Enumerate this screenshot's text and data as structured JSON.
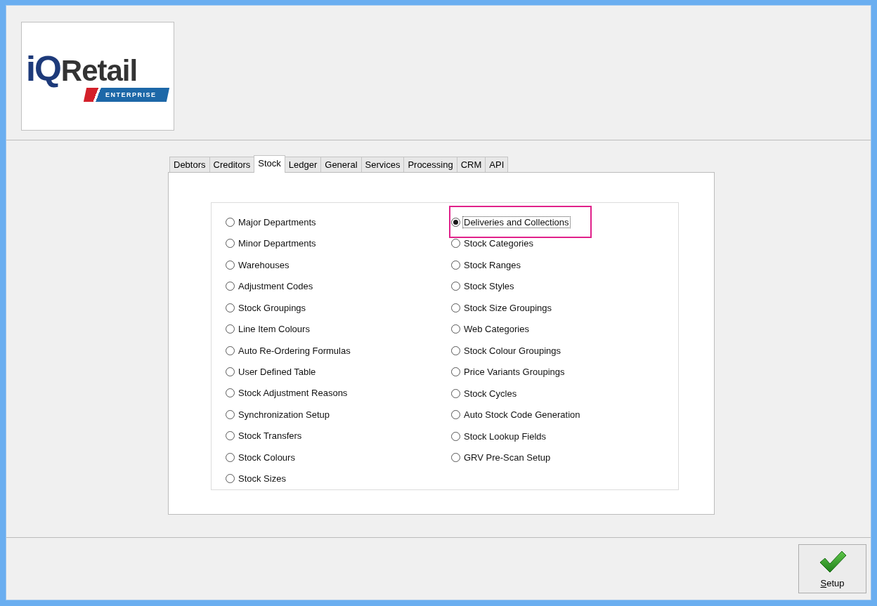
{
  "logo": {
    "mark": "iQ",
    "name": "Retail",
    "tagline": "ENTERPRISE"
  },
  "tabs": [
    {
      "label": "Debtors",
      "selected": false
    },
    {
      "label": "Creditors",
      "selected": false
    },
    {
      "label": "Stock",
      "selected": true
    },
    {
      "label": "Ledger",
      "selected": false
    },
    {
      "label": "General",
      "selected": false
    },
    {
      "label": "Services",
      "selected": false
    },
    {
      "label": "Processing",
      "selected": false
    },
    {
      "label": "CRM",
      "selected": false
    },
    {
      "label": "API",
      "selected": false
    }
  ],
  "columns": [
    {
      "options": [
        {
          "label": "Major Departments",
          "selected": false,
          "highlighted": false
        },
        {
          "label": "Minor Departments",
          "selected": false,
          "highlighted": false
        },
        {
          "label": "Warehouses",
          "selected": false,
          "highlighted": false
        },
        {
          "label": "Adjustment Codes",
          "selected": false,
          "highlighted": false
        },
        {
          "label": "Stock Groupings",
          "selected": false,
          "highlighted": false
        },
        {
          "label": "Line Item Colours",
          "selected": false,
          "highlighted": false
        },
        {
          "label": "Auto Re-Ordering Formulas",
          "selected": false,
          "highlighted": false
        },
        {
          "label": "User Defined Table",
          "selected": false,
          "highlighted": false
        },
        {
          "label": "Stock Adjustment Reasons",
          "selected": false,
          "highlighted": false
        },
        {
          "label": "Synchronization Setup",
          "selected": false,
          "highlighted": false
        },
        {
          "label": "Stock Transfers",
          "selected": false,
          "highlighted": false
        },
        {
          "label": "Stock Colours",
          "selected": false,
          "highlighted": false
        },
        {
          "label": "Stock Sizes",
          "selected": false,
          "highlighted": false
        }
      ]
    },
    {
      "options": [
        {
          "label": "Deliveries and Collections",
          "selected": true,
          "highlighted": true
        },
        {
          "label": "Stock Categories",
          "selected": false,
          "highlighted": false
        },
        {
          "label": "Stock Ranges",
          "selected": false,
          "highlighted": false
        },
        {
          "label": "Stock Styles",
          "selected": false,
          "highlighted": false
        },
        {
          "label": "Stock Size Groupings",
          "selected": false,
          "highlighted": false
        },
        {
          "label": "Web Categories",
          "selected": false,
          "highlighted": false
        },
        {
          "label": "Stock Colour Groupings",
          "selected": false,
          "highlighted": false
        },
        {
          "label": "Price Variants Groupings",
          "selected": false,
          "highlighted": false
        },
        {
          "label": "Stock Cycles",
          "selected": false,
          "highlighted": false
        },
        {
          "label": "Auto Stock Code Generation",
          "selected": false,
          "highlighted": false
        },
        {
          "label": "Stock Lookup Fields",
          "selected": false,
          "highlighted": false
        },
        {
          "label": "GRV Pre-Scan Setup",
          "selected": false,
          "highlighted": false
        }
      ]
    }
  ],
  "buttons": [
    {
      "label": "Setup",
      "kind": "confirm"
    }
  ]
}
